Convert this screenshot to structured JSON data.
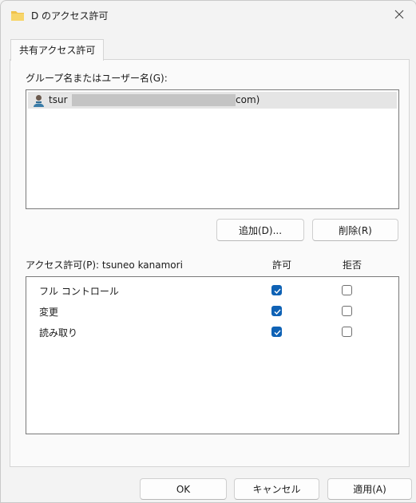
{
  "window": {
    "title": "D のアクセス許可",
    "icons": {
      "title": "folder-icon",
      "close": "close-icon"
    }
  },
  "tab": {
    "label": "共有アクセス許可"
  },
  "group_section": {
    "label": "グループ名またはユーザー名(G):",
    "users": [
      {
        "prefix": "tsur",
        "suffix": "com)",
        "icon": "user-icon",
        "masked": true
      }
    ],
    "buttons": {
      "add": "追加(D)...",
      "remove": "削除(R)"
    }
  },
  "permissions": {
    "label": "アクセス許可(P): tsuneo kanamori",
    "columns": {
      "allow": "許可",
      "deny": "拒否"
    },
    "rows": [
      {
        "name": "フル コントロール",
        "allow": true,
        "deny": false
      },
      {
        "name": "変更",
        "allow": true,
        "deny": false
      },
      {
        "name": "読み取り",
        "allow": true,
        "deny": false
      }
    ]
  },
  "footer": {
    "ok": "OK",
    "cancel": "キャンセル",
    "apply": "適用(A)"
  },
  "colors": {
    "accent": "#0f62b5",
    "selection": "#e5e5e5",
    "window_bg": "#f3f3f3"
  }
}
